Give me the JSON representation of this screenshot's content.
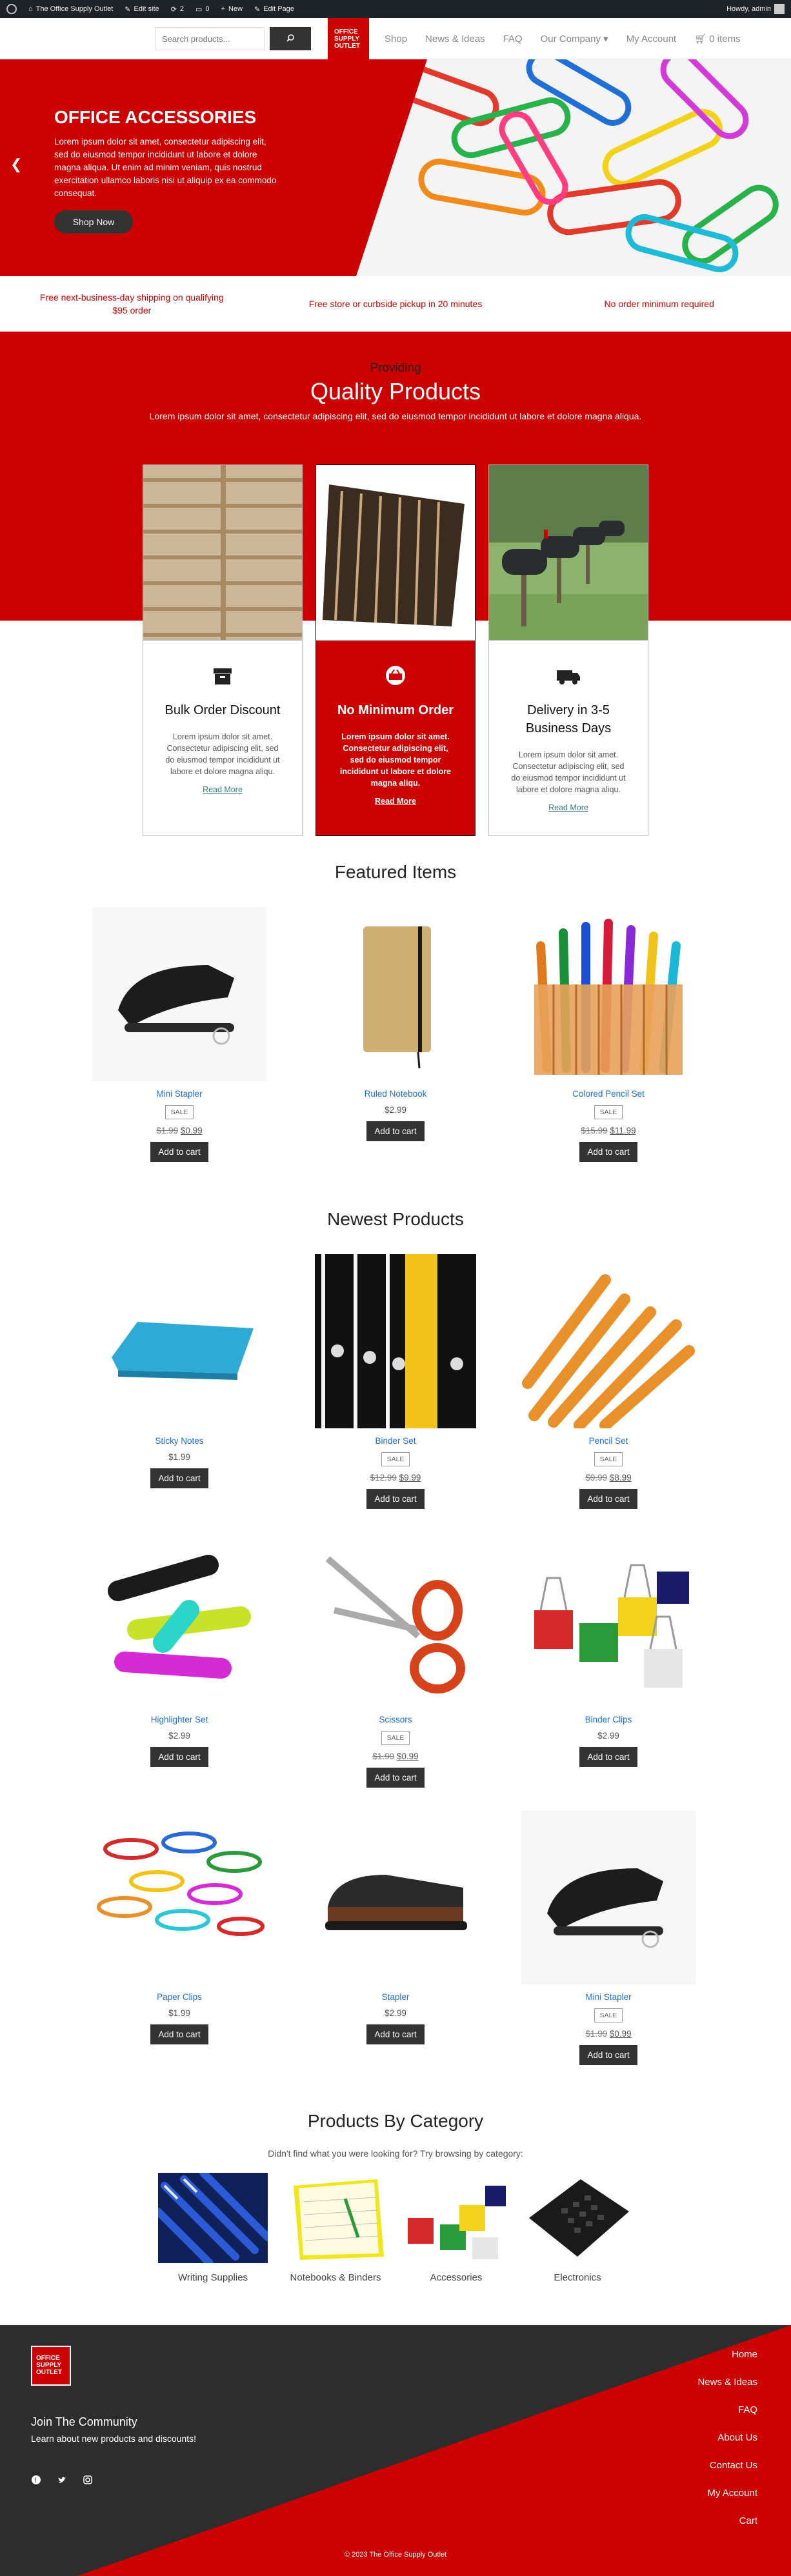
{
  "adminbar": {
    "site": "The Office Supply Outlet",
    "edit_site": "Edit site",
    "updates": "2",
    "comments": "0",
    "new": "New",
    "edit_page": "Edit Page",
    "howdy": "Howdy, admin"
  },
  "header": {
    "search_placeholder": "Search products...",
    "logo_lines": [
      "OFFICE",
      "SUPPLY",
      "OUTLET"
    ],
    "nav": [
      "Shop",
      "News & Ideas",
      "FAQ",
      "Our Company",
      "My Account"
    ],
    "cart_label": "0 items"
  },
  "hero": {
    "title": "OFFICE ACCESSORIES",
    "text": "Lorem ipsum dolor sit amet, consectetur adipiscing elit, sed do eiusmod tempor incididunt ut labore et dolore magna aliqua. Ut enim ad minim veniam, quis nostrud exercitation ullamco laboris nisi ut aliquip ex ea commodo consequat.",
    "button": "Shop Now"
  },
  "benefits": [
    "Free next-business-day shipping on qualifying $95 order",
    "Free store or curbside pickup in 20 minutes",
    "No order minimum required"
  ],
  "providing": {
    "subtitle": "Providing",
    "title": "Quality Products",
    "text": "Lorem ipsum dolor sit amet, consectetur adipiscing elit, sed do eiusmod tempor incididunt ut labore et dolore magna aliqua.",
    "cards": [
      {
        "title": "Bulk Order Discount",
        "text": "Lorem ipsum dolor sit amet. Consectetur adipiscing elit, sed do eiusmod tempor incididunt ut labore et dolore magna aliqu.",
        "link": "Read More",
        "icon": "box-icon"
      },
      {
        "title": "No Minimum Order",
        "text": "Lorem ipsum dolor sit amet. Consectetur adipiscing elit, sed do eiusmod tempor incididunt ut labore et dolore magna aliqu.",
        "link": "Read More",
        "icon": "basket-icon"
      },
      {
        "title": "Delivery in 3-5 Business Days",
        "text": "Lorem ipsum dolor sit amet. Consectetur adipiscing elit, sed do eiusmod tempor incididunt ut labore et dolore magna aliqu.",
        "link": "Read More",
        "icon": "truck-icon"
      }
    ]
  },
  "featured": {
    "title": "Featured Items",
    "items": [
      {
        "name": "Mini Stapler",
        "sale": "SALE",
        "old": "$1.99",
        "price": "$0.99",
        "button": "Add to cart"
      },
      {
        "name": "Ruled Notebook",
        "price": "$2.99",
        "button": "Add to cart"
      },
      {
        "name": "Colored Pencil Set",
        "sale": "SALE",
        "old": "$15.99",
        "price": "$11.99",
        "button": "Add to cart"
      }
    ]
  },
  "newest": {
    "title": "Newest Products",
    "items": [
      {
        "name": "Sticky Notes",
        "price": "$1.99",
        "button": "Add to cart"
      },
      {
        "name": "Binder Set",
        "sale": "SALE",
        "old": "$12.99",
        "price": "$9.99",
        "button": "Add to cart"
      },
      {
        "name": "Pencil Set",
        "sale": "SALE",
        "old": "$9.99",
        "price": "$8.99",
        "button": "Add to cart"
      },
      {
        "name": "Highlighter Set",
        "price": "$2.99",
        "button": "Add to cart"
      },
      {
        "name": "Scissors",
        "sale": "SALE",
        "old": "$1.99",
        "price": "$0.99",
        "button": "Add to cart"
      },
      {
        "name": "Binder Clips",
        "price": "$2.99",
        "button": "Add to cart"
      },
      {
        "name": "Paper Clips",
        "price": "$1.99",
        "button": "Add to cart"
      },
      {
        "name": "Stapler",
        "price": "$2.99",
        "button": "Add to cart"
      },
      {
        "name": "Mini Stapler",
        "sale": "SALE",
        "old": "$1.99",
        "price": "$0.99",
        "button": "Add to cart"
      }
    ]
  },
  "categories": {
    "title": "Products By Category",
    "subtitle": "Didn't find what you were looking for? Try browsing by category:",
    "items": [
      "Writing Supplies",
      "Notebooks & Binders",
      "Accessories",
      "Electronics"
    ]
  },
  "footer": {
    "logo_lines": [
      "OFFICE",
      "SUPPLY",
      "OUTLET"
    ],
    "join": "Join The Community",
    "learn": "Learn about new products and discounts!",
    "nav": [
      "Home",
      "News & Ideas",
      "FAQ",
      "About Us",
      "Contact Us",
      "My Account",
      "Cart"
    ],
    "copyright": "© 2023  The Office Supply Outlet"
  },
  "colors": {
    "accent": "#cc0000",
    "dark": "#333333",
    "link": "#1a6fd8"
  }
}
